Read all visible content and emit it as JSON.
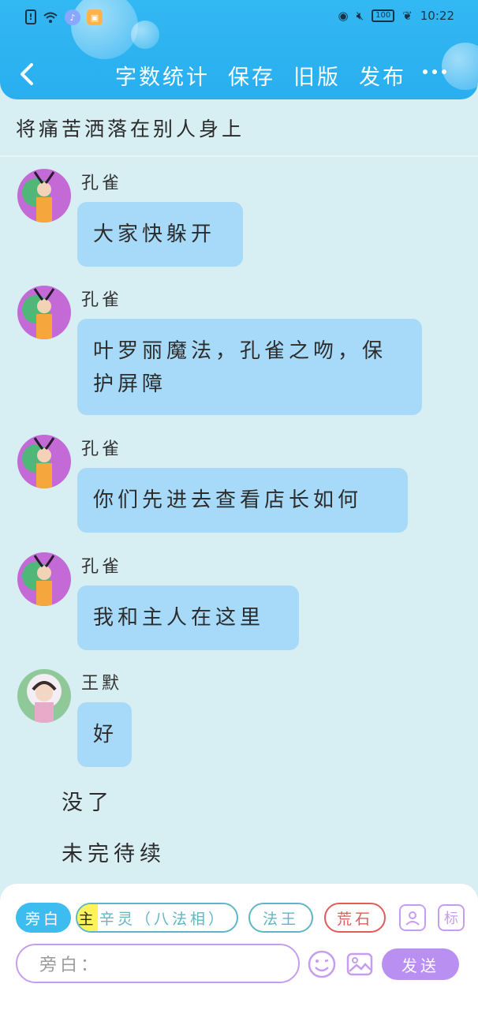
{
  "status_bar": {
    "time": "10:22",
    "battery": "100",
    "sim_icon": "sim-alert-icon",
    "wifi_icon": "wifi-icon",
    "eye_icon": "eye-icon",
    "mute_icon": "mute-icon",
    "leaf_icon": "leaf-icon"
  },
  "toolbar": {
    "actions": [
      "字数统计",
      "保存",
      "旧版",
      "发布"
    ],
    "back_icon": "back-arrow-icon",
    "more_icon": "more-dots-icon"
  },
  "story": {
    "title": "将痛苦洒落在别人身上"
  },
  "messages": [
    {
      "speaker": "孔雀",
      "text": "大家快躲开",
      "avatar": "peacock-avatar"
    },
    {
      "speaker": "孔雀",
      "text": "叶罗丽魔法，孔雀之吻，保护屏障",
      "avatar": "peacock-avatar"
    },
    {
      "speaker": "孔雀",
      "text": "你们先进去查看店长如何",
      "avatar": "peacock-avatar"
    },
    {
      "speaker": "孔雀",
      "text": "我和主人在这里",
      "avatar": "peacock-avatar"
    },
    {
      "speaker": "王默",
      "text": "好",
      "avatar": "wangmo-avatar"
    }
  ],
  "narrations": [
    "没了",
    "未完待续"
  ],
  "composer": {
    "roles": {
      "narration": "旁白",
      "main_tag": "主",
      "xinling": "辛灵（八法相）",
      "fawang": "法王",
      "huangshi": "荒石"
    },
    "tag_button": "标",
    "input_placeholder": "旁白：",
    "send": "发送",
    "colors": {
      "accent": "#3dbcf0",
      "purple": "#b98ff2",
      "teal": "#5fb7c6",
      "red": "#e25a5a",
      "highlight": "#fff35a"
    }
  }
}
